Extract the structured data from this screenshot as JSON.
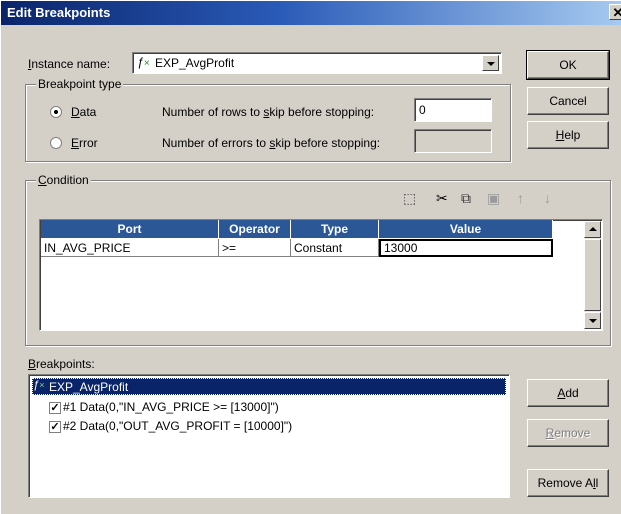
{
  "window": {
    "title": "Edit Breakpoints"
  },
  "instance": {
    "label_prefix": "",
    "label_u": "I",
    "label_rest": "nstance name:",
    "value": "EXP_AvgProfit",
    "icon": "expression-fx-icon"
  },
  "buttons": {
    "ok": "OK",
    "cancel": "Cancel",
    "help_u": "H",
    "help_rest": "elp",
    "add_u": "A",
    "add_rest": "dd",
    "remove_u": "R",
    "remove_rest": "emove",
    "remove_all_pre": "Remove A",
    "remove_all_u": "l",
    "remove_all_post": "l"
  },
  "breakpoint_type": {
    "legend": "Breakpoint type",
    "data_u": "D",
    "data_rest": "ata",
    "error_u": "E",
    "error_rest": "rror",
    "selected": "Data",
    "rows_pre": "Number of rows to ",
    "rows_u": "s",
    "rows_post": "kip before stopping:",
    "rows_value": "0",
    "errors_pre": "Number of errors to ",
    "errors_u": "s",
    "errors_post": "kip before stopping:",
    "errors_value": ""
  },
  "condition": {
    "legend_u": "C",
    "legend_rest": "ondition",
    "toolbar": [
      "new-row-icon",
      "cut-icon",
      "copy-icon",
      "paste-icon",
      "move-up-icon",
      "move-down-icon"
    ],
    "columns": [
      "Port",
      "Operator",
      "Type",
      "Value"
    ],
    "rows": [
      {
        "port": "IN_AVG_PRICE",
        "operator": ">=",
        "type": "Constant",
        "value": "13000"
      }
    ]
  },
  "breakpoints": {
    "label_u": "B",
    "label_rest": "reakpoints:",
    "root": "EXP_AvgProfit",
    "items": [
      {
        "checked": true,
        "text": "#1 Data(0,\"IN_AVG_PRICE >= [13000]\")"
      },
      {
        "checked": true,
        "text": "#2 Data(0,\"OUT_AVG_PROFIT = [10000]\")"
      }
    ]
  },
  "colors": {
    "dialog_bg": "#d4d0c8",
    "title_start": "#0a246a",
    "header_bg": "#2b5797",
    "selection": "#0a246a"
  }
}
